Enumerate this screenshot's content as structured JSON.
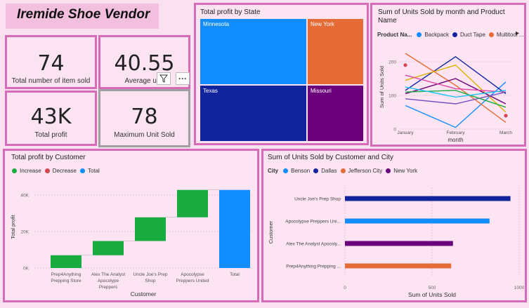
{
  "dashboard": {
    "title": "Iremide Shoe Vendor"
  },
  "kpis": [
    {
      "value": "74",
      "label": "Total number of item sold"
    },
    {
      "value": "40.55",
      "label": "Average unit"
    },
    {
      "value": "43K",
      "label": "Total profit"
    },
    {
      "value": "78",
      "label": "Maximum Unit Sold"
    }
  ],
  "toolbar": {
    "filter_icon": "filter-icon",
    "more_label": "···"
  },
  "treemap": {
    "title": "Total profit by State",
    "tiles": [
      {
        "label": "Minnesota",
        "color": "#118dff"
      },
      {
        "label": "New York",
        "color": "#e66c37"
      },
      {
        "label": "Texas",
        "color": "#12239e"
      },
      {
        "label": "Missouri",
        "color": "#6b007b"
      }
    ]
  },
  "line_chart": {
    "title": "Sum of Units Sold by month and Product Name",
    "legend_title": "Product Na...",
    "legend": [
      {
        "name": "Backpack",
        "color": "#118dff"
      },
      {
        "name": "Duct Tape",
        "color": "#12239e"
      },
      {
        "name": "Multitool ...",
        "color": "#e66c37"
      }
    ],
    "next_icon": "chevron-right-icon",
    "next_label": "▸"
  },
  "waterfall": {
    "title": "Total profit by Customer",
    "legend": [
      {
        "name": "Increase",
        "color": "#1aab40"
      },
      {
        "name": "Decrease",
        "color": "#d64550"
      },
      {
        "name": "Total",
        "color": "#118dff"
      }
    ]
  },
  "barh": {
    "title": "Sum of Units Sold by Customer and City",
    "legend_title": "City",
    "legend": [
      {
        "name": "Benson",
        "color": "#118dff"
      },
      {
        "name": "Dallas",
        "color": "#12239e"
      },
      {
        "name": "Jefferson City",
        "color": "#e66c37"
      },
      {
        "name": "New York",
        "color": "#6b007b"
      }
    ]
  },
  "chart_data": [
    {
      "type": "line",
      "title": "Sum of Units Sold by month and Product Name",
      "xlabel": "month",
      "ylabel": "Sum of Units Sold",
      "categories": [
        "January",
        "February",
        "March"
      ],
      "ylim": [
        0,
        250
      ],
      "yticks": [
        0,
        100,
        200
      ],
      "series": [
        {
          "color": "#118dff",
          "values": [
            70,
            5,
            140
          ]
        },
        {
          "color": "#12239e",
          "values": [
            115,
            215,
            105
          ]
        },
        {
          "color": "#e66c37",
          "values": [
            225,
            130,
            20
          ]
        },
        {
          "color": "#d9b300",
          "values": [
            145,
            190,
            50
          ]
        },
        {
          "color": "#6b007b",
          "values": [
            105,
            150,
            75
          ]
        },
        {
          "color": "#e044a7",
          "values": [
            160,
            120,
            110
          ]
        },
        {
          "color": "#744ec2",
          "values": [
            90,
            75,
            110
          ]
        },
        {
          "color": "#1aab40",
          "values": [
            110,
            115,
            65
          ]
        },
        {
          "color": "#d64550",
          "values": [
            190,
            null,
            40
          ]
        },
        {
          "color": "#15c6f4",
          "values": [
            125,
            95,
            115
          ]
        }
      ]
    },
    {
      "type": "bar",
      "subtype": "waterfall",
      "title": "Total profit by Customer",
      "xlabel": "Customer",
      "ylabel": "Total profit",
      "categories": [
        "Prep4Anything Prepping Store",
        "Alex The Analyst Apocolype Preppers",
        "Uncle Joe's Prep Shop",
        "Apocolypse Preppers United",
        "Total"
      ],
      "values": [
        7000,
        7800,
        13000,
        15000,
        42800
      ],
      "kinds": [
        "increase",
        "increase",
        "increase",
        "increase",
        "total"
      ],
      "ylim": [
        0,
        45000
      ],
      "yticks": [
        0,
        20000,
        40000
      ],
      "ytick_labels": [
        "0K",
        "20K",
        "40K"
      ]
    },
    {
      "type": "bar",
      "subtype": "horizontal",
      "title": "Sum of Units Sold by Customer and City",
      "xlabel": "Sum of Units Sold",
      "ylabel": "Customer",
      "categories": [
        "Uncle Joe's Prep Shop",
        "Apocolypse Preppers Uni...",
        "Alex The Analyst Apocoly...",
        "Prep4Anything Prepping ..."
      ],
      "values": [
        950,
        830,
        620,
        610
      ],
      "colors": [
        "#12239e",
        "#118dff",
        "#6b007b",
        "#e66c37"
      ],
      "xlim": [
        0,
        1000
      ],
      "xticks": [
        0,
        500,
        1000
      ]
    }
  ]
}
